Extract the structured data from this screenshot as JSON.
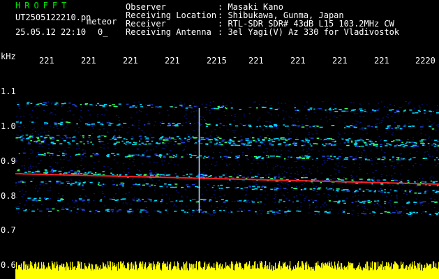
{
  "header": {
    "logo_text": "HROFFT",
    "file_name": "UT2505122210.pn",
    "mode": "meteor",
    "datetime": "25.05.12 22:10",
    "counter": "0_",
    "fields": [
      {
        "label": "Observer",
        "value": ": Masaki Kano"
      },
      {
        "label": "Receiving Location",
        "value": ": Shibukawa, Gunma, Japan"
      },
      {
        "label": "Receiver",
        "value": ": RTL-SDR SDR# 43dB L15 103.2MHz CW"
      },
      {
        "label": "Receiving Antenna",
        "value": ": 3el Yagi(V) Az 330 for Vladivostok"
      }
    ]
  },
  "axes": {
    "y_unit": "kHz",
    "y_ticks": [
      "1.1",
      "1.0",
      "0.9",
      "0.8",
      "0.7",
      "0.6"
    ],
    "x_ticks": [
      "221",
      "221",
      "221",
      "221",
      "2215",
      "221",
      "221",
      "221",
      "221",
      "2220"
    ]
  },
  "colors": {
    "background": "#000000",
    "text": "#ffffff",
    "logo": "#00e000",
    "noise_low": "#0a1a8a",
    "noise_mid": "#00d8ff",
    "band_hot": "#ff2020",
    "amplitude_strip": "#ffff00"
  },
  "chart_data": {
    "type": "heatmap",
    "ylabel": "kHz",
    "ylim": [
      0.6,
      1.15
    ],
    "bands": [
      {
        "freq_start": 1.065,
        "freq_end": 1.04,
        "intensity": 0.35
      },
      {
        "freq_start": 1.01,
        "freq_end": 0.995,
        "intensity": 0.3
      },
      {
        "freq_start": 0.97,
        "freq_end": 0.955,
        "intensity": 0.7
      },
      {
        "freq_start": 0.955,
        "freq_end": 0.945,
        "intensity": 0.6
      },
      {
        "freq_start": 0.92,
        "freq_end": 0.905,
        "intensity": 0.5
      },
      {
        "freq_start": 0.87,
        "freq_end": 0.835,
        "intensity": 1.0
      },
      {
        "freq_start": 0.84,
        "freq_end": 0.81,
        "intensity": 0.45
      },
      {
        "freq_start": 0.79,
        "freq_end": 0.78,
        "intensity": 0.3
      },
      {
        "freq_start": 0.76,
        "freq_end": 0.75,
        "intensity": 0.25
      }
    ],
    "meteor_time_fraction": 0.434,
    "meteor_freq_range": [
      0.75,
      1.05
    ]
  }
}
